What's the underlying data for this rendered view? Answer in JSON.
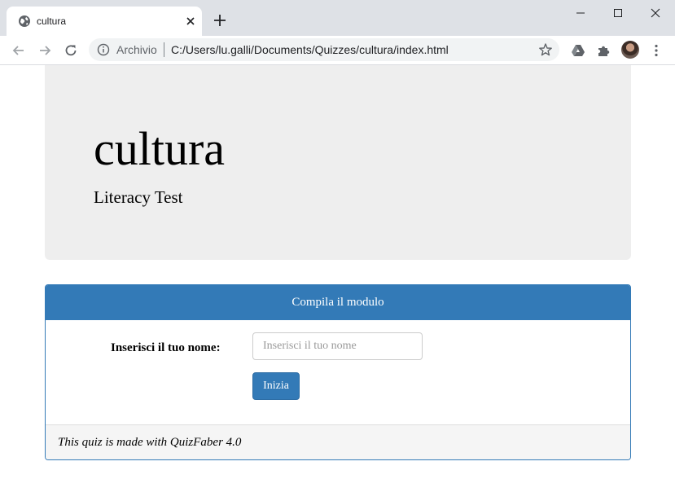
{
  "browser": {
    "tab": {
      "title": "cultura",
      "favicon_icon": "globe-icon",
      "close_icon": "close-icon"
    },
    "new_tab_icon": "plus-icon",
    "window_controls": [
      "minimize-icon",
      "maximize-icon",
      "close-icon"
    ],
    "toolbar": {
      "back_icon": "arrow-left-icon",
      "forward_icon": "arrow-right-icon",
      "reload_icon": "reload-icon",
      "info_icon": "info-icon",
      "scheme_label": "Archivio",
      "url": "C:/Users/lu.galli/Documents/Quizzes/cultura/index.html",
      "bookmark_icon": "star-icon",
      "extensions": [
        "drive-icon",
        "puzzle-icon"
      ],
      "menu_icon": "kebab-menu-icon"
    }
  },
  "page": {
    "jumbotron": {
      "title": "cultura",
      "subtitle": "Literacy Test"
    },
    "form_panel": {
      "heading": "Compila il modulo",
      "name_label": "Inserisci il tuo nome:",
      "name_placeholder": "Inserisci il tuo nome",
      "name_value": "",
      "start_button": "Inizia",
      "footer": "This quiz is made with QuizFaber 4.0"
    }
  },
  "colors": {
    "primary": "#337ab7",
    "jumbotron_bg": "#eeeeee",
    "footer_bg": "#f5f5f5",
    "tabstrip_bg": "#dee1e6"
  }
}
